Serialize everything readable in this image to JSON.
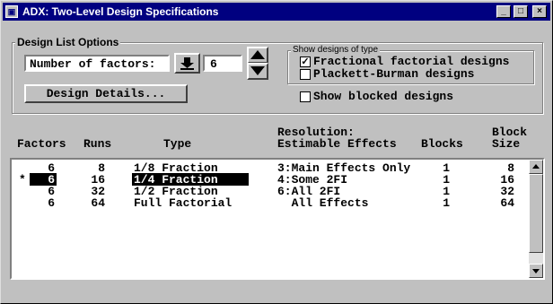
{
  "window": {
    "title": "ADX: Two-Level Design Specifications",
    "min_label": "_",
    "max_label": "□",
    "close_label": "×"
  },
  "options": {
    "group_label": "Design List Options",
    "factors_label": "Number of factors:",
    "factors_value": "6",
    "details_button": "Design Details..."
  },
  "show": {
    "group_label": "Show designs of type",
    "fractional": {
      "label": "Fractional factorial designs",
      "checked": true
    },
    "plackett": {
      "label": "Plackett-Burman designs",
      "checked": false
    },
    "blocked": {
      "label": "Show blocked designs",
      "checked": false
    }
  },
  "table": {
    "headers": {
      "factors": "Factors",
      "runs": "Runs",
      "type": "Type",
      "res_line1": "Resolution:",
      "res_line2": "Estimable Effects",
      "blocks": "Blocks",
      "blocksize_line1": "Block",
      "blocksize_line2": "Size"
    },
    "rows": [
      {
        "marker": "",
        "factors": "6",
        "runs": "8",
        "type": "1/8 Fraction",
        "resolution": "3:Main Effects Only",
        "blocks": "1",
        "block_size": "8",
        "selected": false
      },
      {
        "marker": "*",
        "factors": "6",
        "runs": "16",
        "type": "1/4 Fraction",
        "resolution": "4:Some 2FI",
        "blocks": "1",
        "block_size": "16",
        "selected": true
      },
      {
        "marker": "",
        "factors": "6",
        "runs": "32",
        "type": "1/2 Fraction",
        "resolution": "6:All 2FI",
        "blocks": "1",
        "block_size": "32",
        "selected": false
      },
      {
        "marker": "",
        "factors": "6",
        "runs": "64",
        "type": "Full Factorial",
        "resolution": "  All Effects",
        "blocks": "1",
        "block_size": "64",
        "selected": false
      }
    ]
  },
  "colors": {
    "titlebar": "#000080",
    "face": "#c0c0c0",
    "selection": "#000000"
  }
}
